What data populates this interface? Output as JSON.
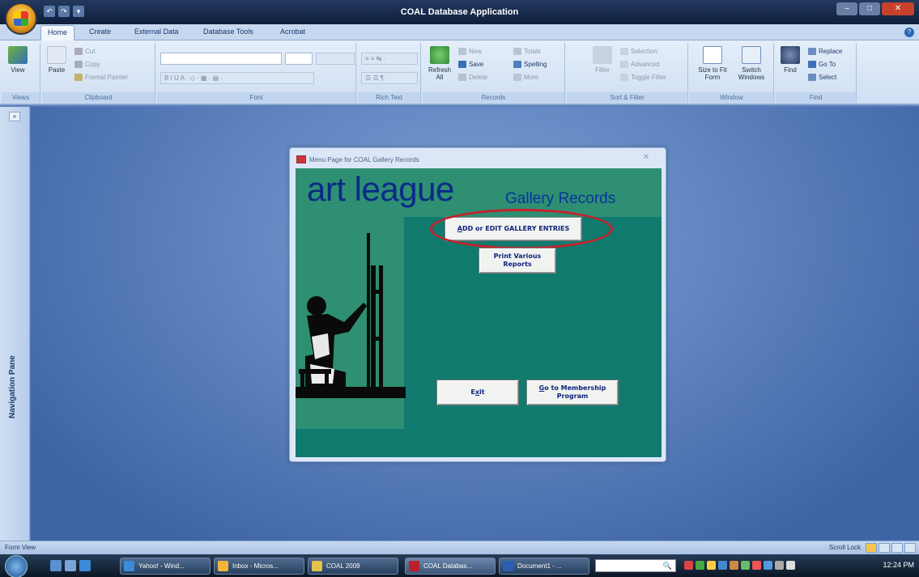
{
  "window": {
    "title": "COAL Database Application"
  },
  "quick_access": [
    "↶",
    "↷",
    "▾"
  ],
  "window_controls": [
    "–",
    "□",
    "✕"
  ],
  "ribbon_tabs": [
    "Home",
    "Create",
    "External Data",
    "Database Tools",
    "Acrobat"
  ],
  "ribbon": {
    "views": {
      "view_label": "View",
      "group": "Views"
    },
    "clipboard": {
      "paste": "Paste",
      "cut": "Cut",
      "copy": "Copy",
      "format_painter": "Format Painter",
      "group": "Clipboard"
    },
    "font": {
      "group": "Font",
      "format_row": "B  I  U  A ·  ◇ ·  ▦ ·  ▤ ·"
    },
    "rich_text": {
      "group": "Rich Text",
      "row1": "≡  ≡  ↹ ·",
      "row2": "☰  ☰  ¶ ·"
    },
    "records": {
      "refresh": "Refresh All",
      "new": "New",
      "save": "Save",
      "delete": "Delete",
      "totals": "Totals",
      "spelling": "Spelling",
      "more": "More",
      "group": "Records"
    },
    "sort_filter": {
      "filter": "Filter",
      "selection": "Selection",
      "advanced": "Advanced",
      "toggle_filter": "Toggle Filter",
      "group": "Sort & Filter"
    },
    "window": {
      "size_to_fit": "Size to Fit Form",
      "switch_windows": "Switch Windows",
      "group": "Window"
    },
    "find": {
      "find": "Find",
      "replace": "Replace",
      "go_to": "Go To",
      "select": "Select",
      "group": "Find"
    }
  },
  "nav_pane": {
    "label": "Navigation Pane",
    "toggle": "»"
  },
  "form": {
    "title": "Menu Page for COAL Gallery Records",
    "close": "✕",
    "brand": "art league",
    "subtitle": "Gallery Records",
    "buttons": {
      "add_edit_access": "A",
      "add_edit": "DD or EDIT GALLERY ENTRIES",
      "print_reports": "Print Various Reports",
      "exit_pre": "E",
      "exit_access": "x",
      "exit_post": "it",
      "membership_access": "G",
      "membership": "o to Membership Program"
    }
  },
  "status_bar": {
    "left": "Form View",
    "right": "Scroll Lock"
  },
  "taskbar": {
    "items": [
      "Yahoo! - Wind...",
      "Inbox - Micros...",
      "COAL 2009",
      "COAL Databas...",
      "Document1 - ..."
    ],
    "search": "🔍",
    "clock": "12:24 PM"
  },
  "colors": {
    "form_bg": "#117a6e",
    "panel": "#2e8f72",
    "brand": "#0a2a8a",
    "highlight": "#c8202a"
  }
}
